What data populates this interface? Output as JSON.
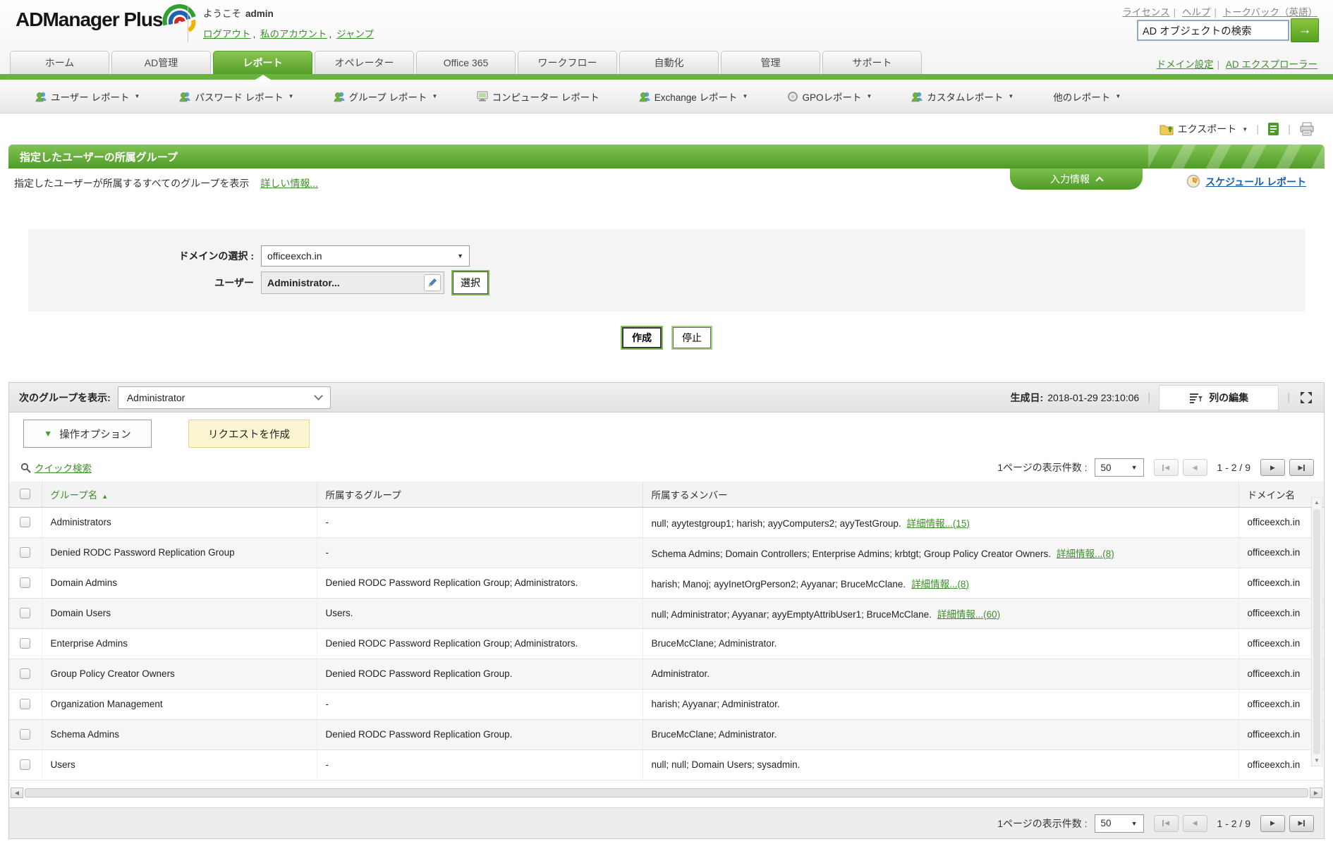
{
  "header": {
    "logo_text": "ADManager Plus",
    "welcome_label": "ようこそ",
    "username": "admin",
    "link_logout": "ログアウト",
    "link_my_account": "私のアカウント",
    "link_jump": "ジャンプ",
    "link_license": "ライセンス",
    "link_help": "ヘルプ",
    "link_feedback": "トークバック（英語）",
    "search_value": "AD オブジェクトの検索",
    "link_domain_settings": "ドメイン設定",
    "link_ad_explorer": "AD エクスプローラー"
  },
  "nav": {
    "tabs": [
      "ホーム",
      "AD管理",
      "レポート",
      "オペレーター",
      "Office 365",
      "ワークフロー",
      "自動化",
      "管理",
      "サポート"
    ],
    "active_tab": "レポート"
  },
  "submenu": {
    "items": [
      {
        "label": "ユーザー レポート"
      },
      {
        "label": "パスワード レポート"
      },
      {
        "label": "グループ レポート"
      },
      {
        "label": "コンピューター レポート"
      },
      {
        "label": "Exchange レポート"
      },
      {
        "label": "GPOレポート"
      },
      {
        "label": "カスタムレポート"
      },
      {
        "label": "他のレポート"
      }
    ]
  },
  "toolbar_top": {
    "export_label": "エクスポート"
  },
  "report": {
    "title": "指定したユーザーの所属グループ",
    "subtitle": "指定したユーザーが所属するすべてのグループを表示",
    "more_info_link": "詳しい情報...",
    "input_info_tab": "入力情報",
    "schedule_link": "スケジュール レポート",
    "form": {
      "domain_label": "ドメインの選択 :",
      "domain_value": "officeexch.in",
      "user_label": "ユーザー",
      "user_value": "Administrator...",
      "select_button": "選択",
      "generate_button": "作成",
      "stop_button": "停止"
    }
  },
  "results": {
    "show_group_label": "次のグループを表示:",
    "show_group_value": "Administrator",
    "generated_label": "生成日:",
    "generated_value": "2018-01-29 23:10:06",
    "edit_columns_button": "列の編集",
    "actions_button": "操作オプション",
    "create_request_button": "リクエストを作成",
    "quick_search_link": "クイック検索",
    "pagination": {
      "per_page_label": "1ページの表示件数 :",
      "per_page_value": "50",
      "range": "1 - 2 /  9"
    },
    "table": {
      "columns": [
        "グループ名",
        "所属するグループ",
        "所属するメンバー",
        "ドメイン名"
      ],
      "rows": [
        {
          "group": "Administrators",
          "member_of": "-",
          "members": "null; ayytestgroup1; harish; ayyComputers2; ayyTestGroup.",
          "more": "詳細情報...(15)",
          "domain": "officeexch.in"
        },
        {
          "group": "Denied RODC Password Replication Group",
          "member_of": "-",
          "members": "Schema Admins; Domain Controllers; Enterprise Admins; krbtgt; Group Policy Creator Owners.",
          "more": "詳細情報...(8)",
          "domain": "officeexch.in"
        },
        {
          "group": "Domain Admins",
          "member_of": "Denied RODC Password Replication Group; Administrators.",
          "members": "harish; Manoj; ayyInetOrgPerson2; Ayyanar; BruceMcClane.",
          "more": "詳細情報...(8)",
          "domain": "officeexch.in"
        },
        {
          "group": "Domain Users",
          "member_of": "Users.",
          "members": "null; Administrator; Ayyanar; ayyEmptyAttribUser1; BruceMcClane.",
          "more": "詳細情報...(60)",
          "domain": "officeexch.in"
        },
        {
          "group": "Enterprise Admins",
          "member_of": "Denied RODC Password Replication Group; Administrators.",
          "members": "BruceMcClane; Administrator.",
          "more": "",
          "domain": "officeexch.in"
        },
        {
          "group": "Group Policy Creator Owners",
          "member_of": "Denied RODC Password Replication Group.",
          "members": "Administrator.",
          "more": "",
          "domain": "officeexch.in"
        },
        {
          "group": "Organization Management",
          "member_of": "-",
          "members": "harish; Ayyanar; Administrator.",
          "more": "",
          "domain": "officeexch.in"
        },
        {
          "group": "Schema Admins",
          "member_of": "Denied RODC Password Replication Group.",
          "members": "BruceMcClane; Administrator.",
          "more": "",
          "domain": "officeexch.in"
        },
        {
          "group": "Users",
          "member_of": "-",
          "members": "null; null; Domain Users; sysadmin.",
          "more": "",
          "domain": "officeexch.in"
        }
      ]
    }
  },
  "icons": {
    "caret_down": "▼",
    "sort_asc": "▲",
    "arrow_left": "◀",
    "arrow_right": "▶",
    "go_arrow": "→",
    "scroll_up": "▲",
    "scroll_down": "▼"
  },
  "colors": {
    "brand_green": "#69b33e",
    "link_green": "#3e8e2a",
    "link_blue": "#1a5dab",
    "request_button_bg": "#fdf5d2"
  }
}
